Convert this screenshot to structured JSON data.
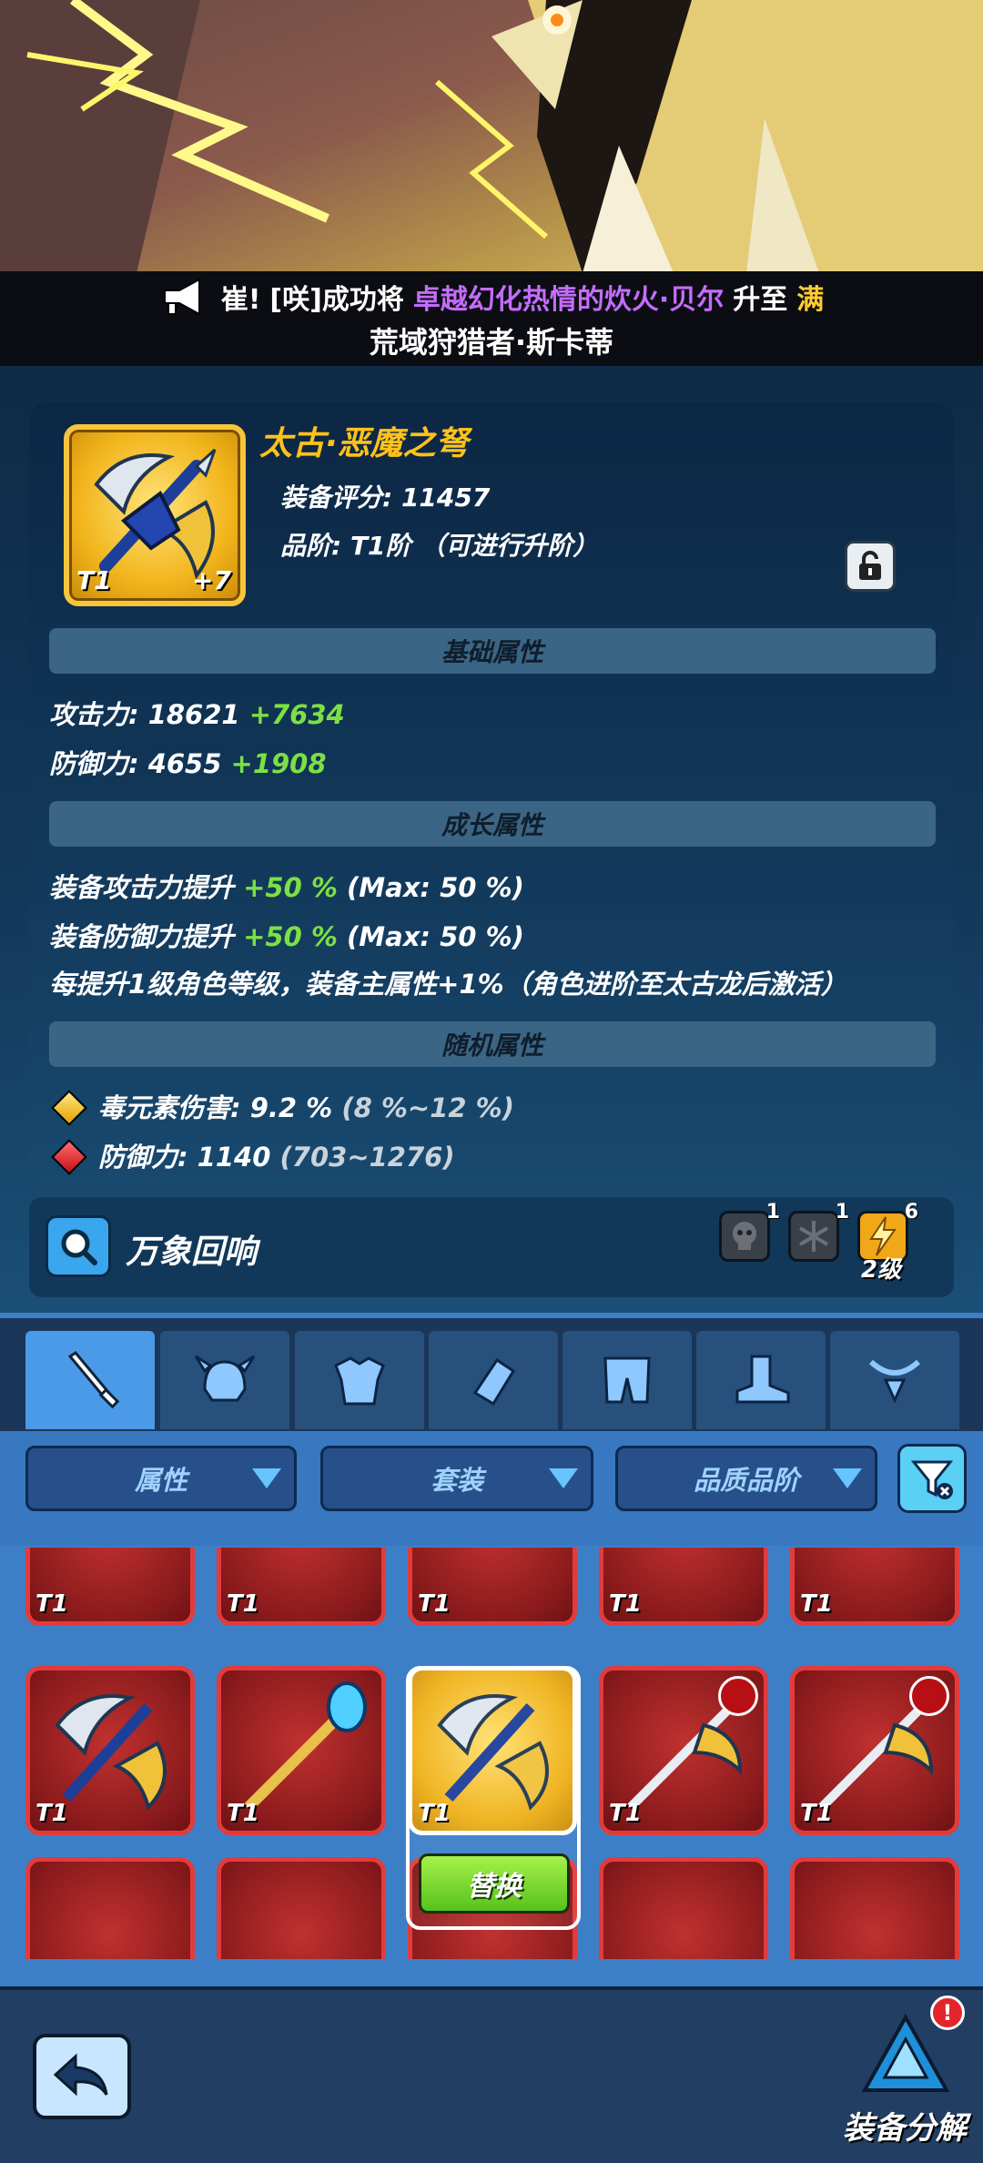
{
  "ticker": {
    "prefix": "[咲]成功将",
    "highlight": "卓越幻化热情的炊火·贝尔",
    "middle": "升至",
    "suffix": "满",
    "sub_line": "荒域狩猎者·斯卡蒂",
    "head_fragment": "崔!"
  },
  "item": {
    "name": "太古·恶魔之弩",
    "score": "装备评分: 11457",
    "grade": "品阶: T1阶 （可进行升阶）",
    "tier": "T1",
    "level": "+7"
  },
  "sections": {
    "base": "基础属性",
    "growth": "成长属性",
    "random": "随机属性"
  },
  "base_stats": {
    "attack_label": "攻击力: 18621",
    "attack_bonus": "+7634",
    "defense_label": "防御力: 4655",
    "defense_bonus": "+1908"
  },
  "growth_stats": {
    "atk_label": "装备攻击力提升",
    "atk_value": "+50 %",
    "atk_max": "(Max: 50 %)",
    "def_label": "装备防御力提升",
    "def_value": "+50 %",
    "def_max": "(Max: 50 %)",
    "note": "每提升1级角色等级，装备主属性+1%（角色进阶至太古龙后激活）"
  },
  "random_stats": {
    "row1_label": "毒元素伤害: 9.2 %",
    "row1_range": "(8 %~12 %)",
    "row2_label": "防御力: 1140",
    "row2_range": "(703~1276)"
  },
  "echo": {
    "label": "万象回响",
    "slot1_count": "1",
    "slot2_count": "1",
    "slot3_count": "6",
    "slot3_level": "2级"
  },
  "filters": {
    "attr": "属性",
    "set": "套装",
    "quality": "品质品阶"
  },
  "inventory": {
    "tier_label": "T1",
    "replace": "替换"
  },
  "bottom": {
    "dismantle": "装备分解",
    "alert": "!"
  },
  "colors": {
    "accent_gold": "#ffc21a",
    "bonus_green": "#7ce043",
    "ticker_purple": "#c46cff",
    "panel_blue": "#12385a"
  }
}
